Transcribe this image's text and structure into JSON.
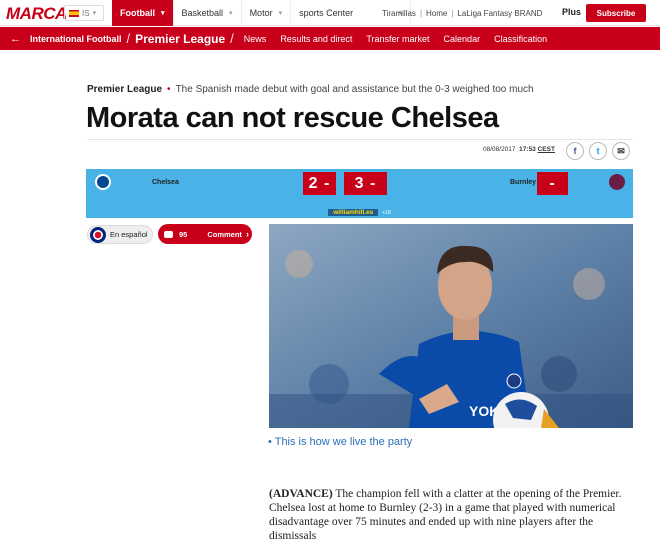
{
  "header": {
    "logo": "MARCA",
    "edition": "IS",
    "nav": [
      {
        "label": "Football",
        "active": true
      },
      {
        "label": "Basketball",
        "active": false
      },
      {
        "label": "Motor",
        "active": false
      },
      {
        "label": "sports Center",
        "active": false
      }
    ],
    "links": [
      "Tiramillas",
      "Home",
      "LaLiga Fantasy BRAND"
    ],
    "plus": "Plus",
    "subscribe": "Subscribe"
  },
  "subnav": {
    "back_icon": "arrow-left-icon",
    "section": "International Football",
    "current": "Premier League",
    "items": [
      "News",
      "Results and direct",
      "Transfer market",
      "Calendar",
      "Classification"
    ]
  },
  "article": {
    "kicker": "Premier League",
    "summary": "The Spanish made debut with goal and assistance but the 0-3 weighed too much",
    "title": "Morata can not rescue Chelsea",
    "date": "08/08/2017",
    "time": "17:53",
    "timezone": "CEST",
    "caption_link": "This is how we live the party",
    "lead": "(ADVANCE)",
    "body": "The champion fell with a clatter at the opening of the Premier. Chelsea lost at home to Burnley (2-3) in a game that played with numerical disadvantage over 75 minutes and ended up with nine players after the dismissals"
  },
  "scoreboard": {
    "home_team": "Chelsea",
    "away_team": "Burnley",
    "home_score": "2 -",
    "away_score": "3 -",
    "extra_score": "-",
    "sponsor_name": "william",
    "sponsor_accent": "hill",
    "sponsor_tld": ".es",
    "age": "+18"
  },
  "actions": {
    "language": "En español",
    "comment_count": "95",
    "comment_label": "Comment"
  },
  "colors": {
    "brand": "#c8001a",
    "scoreboard": "#49b3e8",
    "link": "#2b6fb6"
  }
}
